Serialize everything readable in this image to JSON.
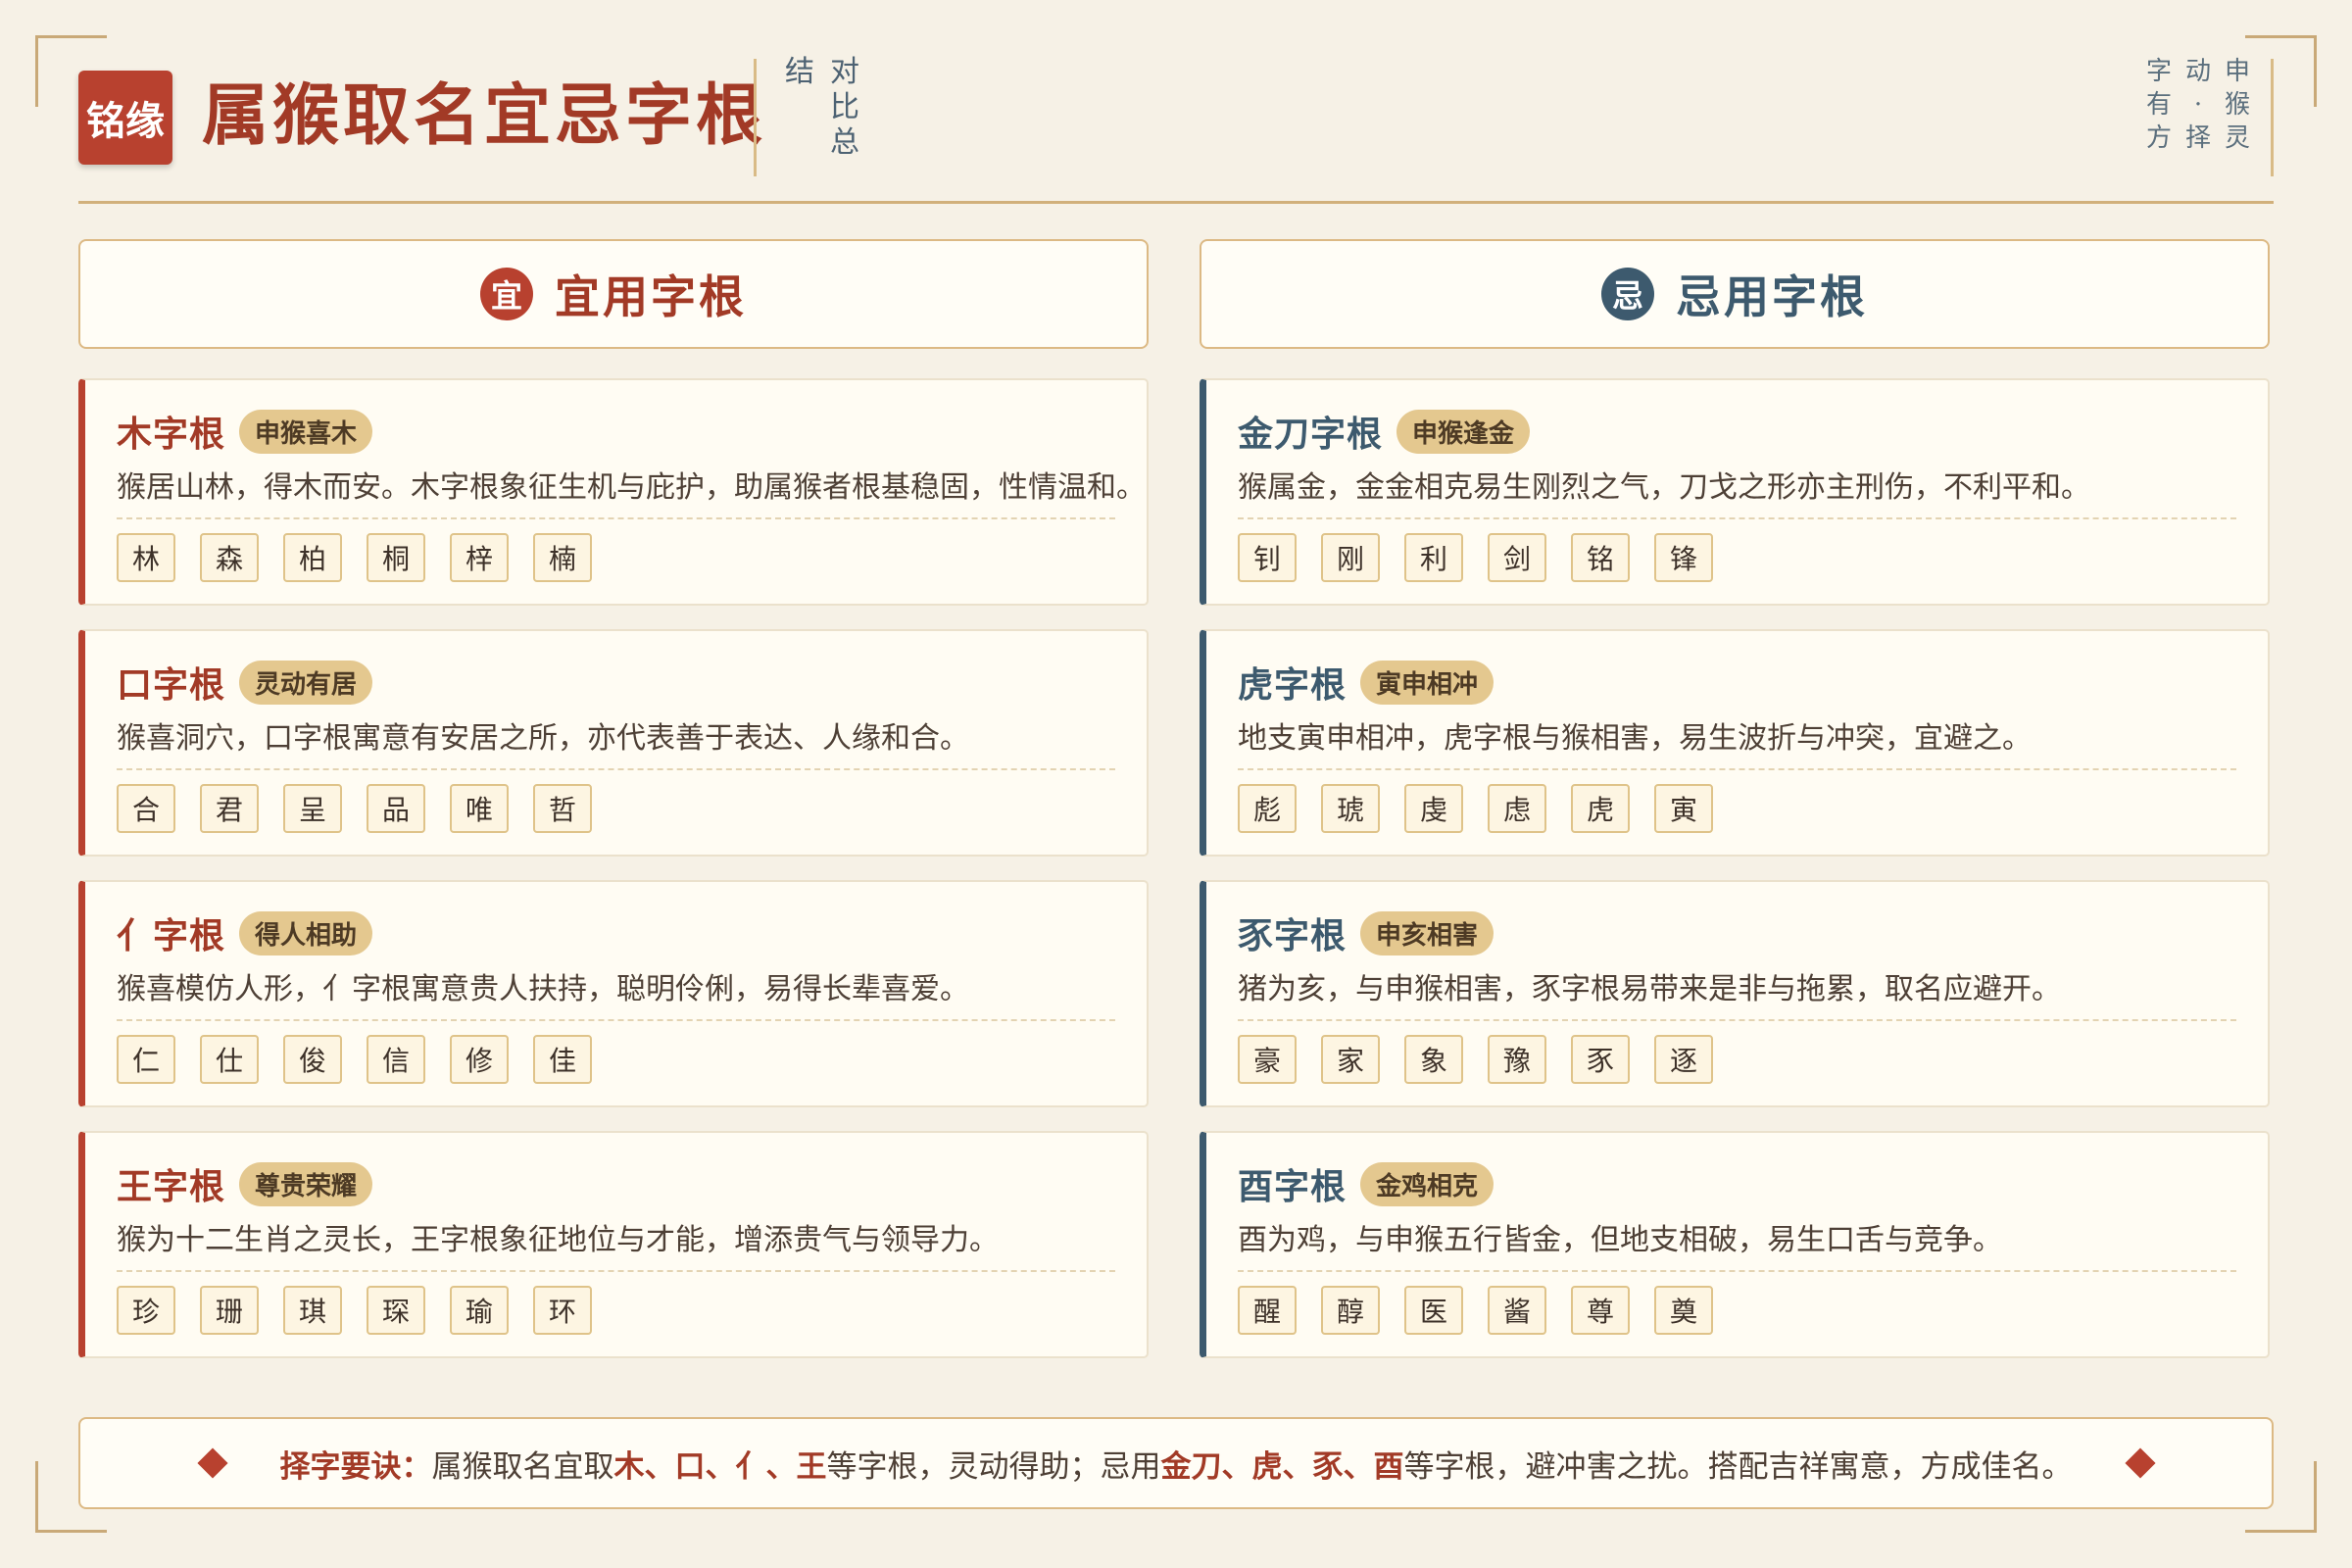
{
  "header": {
    "logo": "铭缘",
    "title": "属猴取名宜忌字根",
    "subtitle_columns": [
      "对比",
      "结",
      "总"
    ],
    "motto_columns": [
      "申猴灵",
      "动·择",
      "字有方"
    ]
  },
  "left_section": {
    "icon": "宜",
    "title": "宜用字根"
  },
  "right_section": {
    "icon": "忌",
    "title": "忌用字根"
  },
  "good_cards": [
    {
      "name": "木字根",
      "tag": "申猴喜木",
      "desc": "猴居山林，得木而安。木字根象征生机与庇护，助属猴者根基稳固，性情温和。",
      "chars": [
        "林",
        "森",
        "柏",
        "桐",
        "梓",
        "楠"
      ]
    },
    {
      "name": "口字根",
      "tag": "灵动有居",
      "desc": "猴喜洞穴，口字根寓意有安居之所，亦代表善于表达、人缘和合。",
      "chars": [
        "合",
        "君",
        "呈",
        "品",
        "唯",
        "哲"
      ]
    },
    {
      "name": "亻字根",
      "tag": "得人相助",
      "desc": "猴喜模仿人形，亻字根寓意贵人扶持，聪明伶俐，易得长辈喜爱。",
      "chars": [
        "仁",
        "仕",
        "俊",
        "信",
        "修",
        "佳"
      ]
    },
    {
      "name": "王字根",
      "tag": "尊贵荣耀",
      "desc": "猴为十二生肖之灵长，王字根象征地位与才能，增添贵气与领导力。",
      "chars": [
        "珍",
        "珊",
        "琪",
        "琛",
        "瑜",
        "环"
      ]
    }
  ],
  "bad_cards": [
    {
      "name": "金刀字根",
      "tag": "申猴逢金",
      "desc": "猴属金，金金相克易生刚烈之气，刀戈之形亦主刑伤，不利平和。",
      "chars": [
        "钊",
        "刚",
        "利",
        "剑",
        "铭",
        "锋"
      ]
    },
    {
      "name": "虎字根",
      "tag": "寅申相冲",
      "desc": "地支寅申相冲，虎字根与猴相害，易生波折与冲突，宜避之。",
      "chars": [
        "彪",
        "琥",
        "虔",
        "虑",
        "虎",
        "寅"
      ]
    },
    {
      "name": "豕字根",
      "tag": "申亥相害",
      "desc": "猪为亥，与申猴相害，豕字根易带来是非与拖累，取名应避开。",
      "chars": [
        "豪",
        "家",
        "象",
        "豫",
        "豕",
        "逐"
      ]
    },
    {
      "name": "酉字根",
      "tag": "金鸡相克",
      "desc": "酉为鸡，与申猴五行皆金，但地支相破，易生口舌与竞争。",
      "chars": [
        "醒",
        "醇",
        "医",
        "酱",
        "尊",
        "奠"
      ]
    }
  ],
  "footer": {
    "label": "择字要诀：",
    "text1": "属猴取名宜取",
    "good_roots": "木、口、亻、王",
    "text2": "等字根，灵动得助；忌用",
    "bad_roots": "金刀、虎、豕、酉",
    "text3": "等字根，避冲害之扰。搭配吉祥寓意，方成佳名。"
  },
  "colors": {
    "accent_red": "#b8412f",
    "accent_blue": "#3d5a6e",
    "gold": "#e4c88f",
    "background": "#f6f1e6"
  }
}
